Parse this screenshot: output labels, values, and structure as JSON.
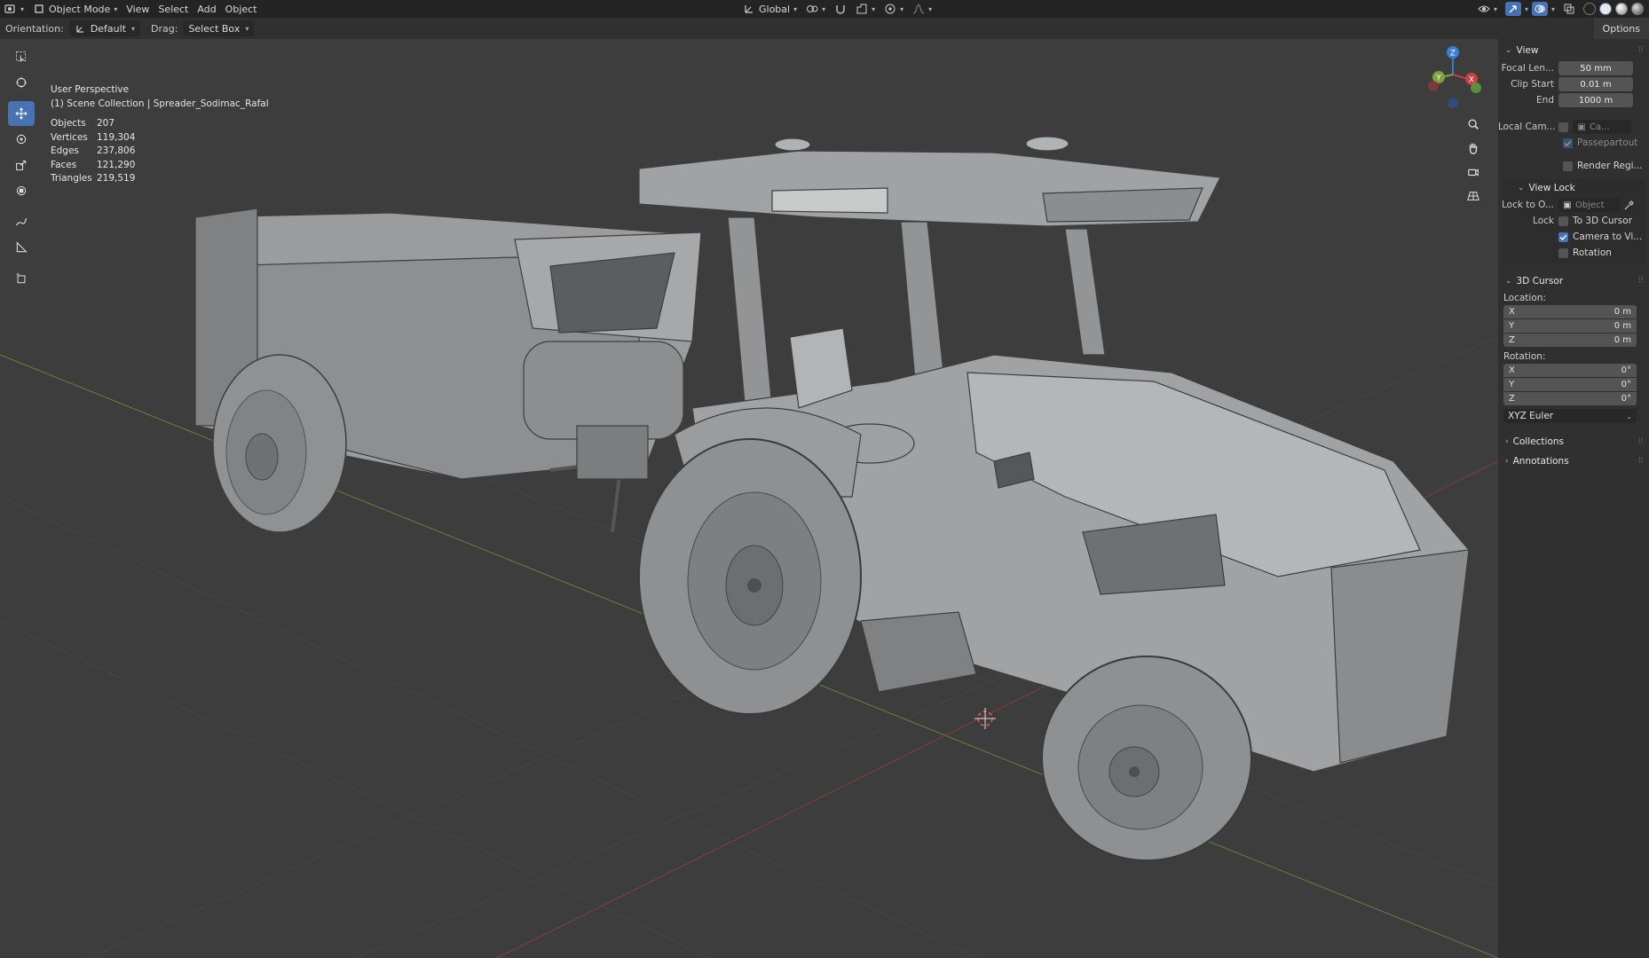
{
  "header": {
    "mode": "Object Mode",
    "menus": [
      "View",
      "Select",
      "Add",
      "Object"
    ],
    "transform_orientation": "Global"
  },
  "toolsettings": {
    "orientation_label": "Orientation:",
    "orientation_value": "Default",
    "drag_label": "Drag:",
    "drag_value": "Select Box",
    "options_label": "Options"
  },
  "overlay": {
    "view_name": "User Perspective",
    "collection": "(1) Scene Collection | Spreader_Sodimac_Rafal",
    "stats": [
      {
        "label": "Objects",
        "value": "207"
      },
      {
        "label": "Vertices",
        "value": "119,304"
      },
      {
        "label": "Edges",
        "value": "237,806"
      },
      {
        "label": "Faces",
        "value": "121,290"
      },
      {
        "label": "Triangles",
        "value": "219,519"
      }
    ]
  },
  "gizmo": {
    "x": "X",
    "y": "Y",
    "z": "Z"
  },
  "sidebar": {
    "view": {
      "title": "View",
      "focal_label": "Focal Len...",
      "focal_value": "50 mm",
      "clip_start_label": "Clip Start",
      "clip_start_value": "0.01 m",
      "end_label": "End",
      "end_value": "1000 m",
      "local_cam_label": "Local Cam...",
      "local_cam_value": "Ca...",
      "passepartout": "Passepartout",
      "render_region": "Render Regi..."
    },
    "view_lock": {
      "title": "View Lock",
      "lock_to_label": "Lock to O...",
      "lock_to_value": "Object",
      "lock_label": "Lock",
      "to_cursor": "To 3D Cursor",
      "camera_to_view": "Camera to Vi...",
      "rotation": "Rotation"
    },
    "cursor": {
      "title": "3D Cursor",
      "location_label": "Location:",
      "location": [
        {
          "axis": "X",
          "value": "0 m"
        },
        {
          "axis": "Y",
          "value": "0 m"
        },
        {
          "axis": "Z",
          "value": "0 m"
        }
      ],
      "rotation_label": "Rotation:",
      "rotation": [
        {
          "axis": "X",
          "value": "0°"
        },
        {
          "axis": "Y",
          "value": "0°"
        },
        {
          "axis": "Z",
          "value": "0°"
        }
      ],
      "rotation_mode": "XYZ Euler"
    },
    "collections": "Collections",
    "annotations": "Annotations"
  },
  "colors": {
    "accent": "#4772b3",
    "axis_x": "#c8403f",
    "axis_y": "#7fa33a",
    "axis_z": "#3a7cd6",
    "viewport_bg": "#3d3d3d"
  }
}
